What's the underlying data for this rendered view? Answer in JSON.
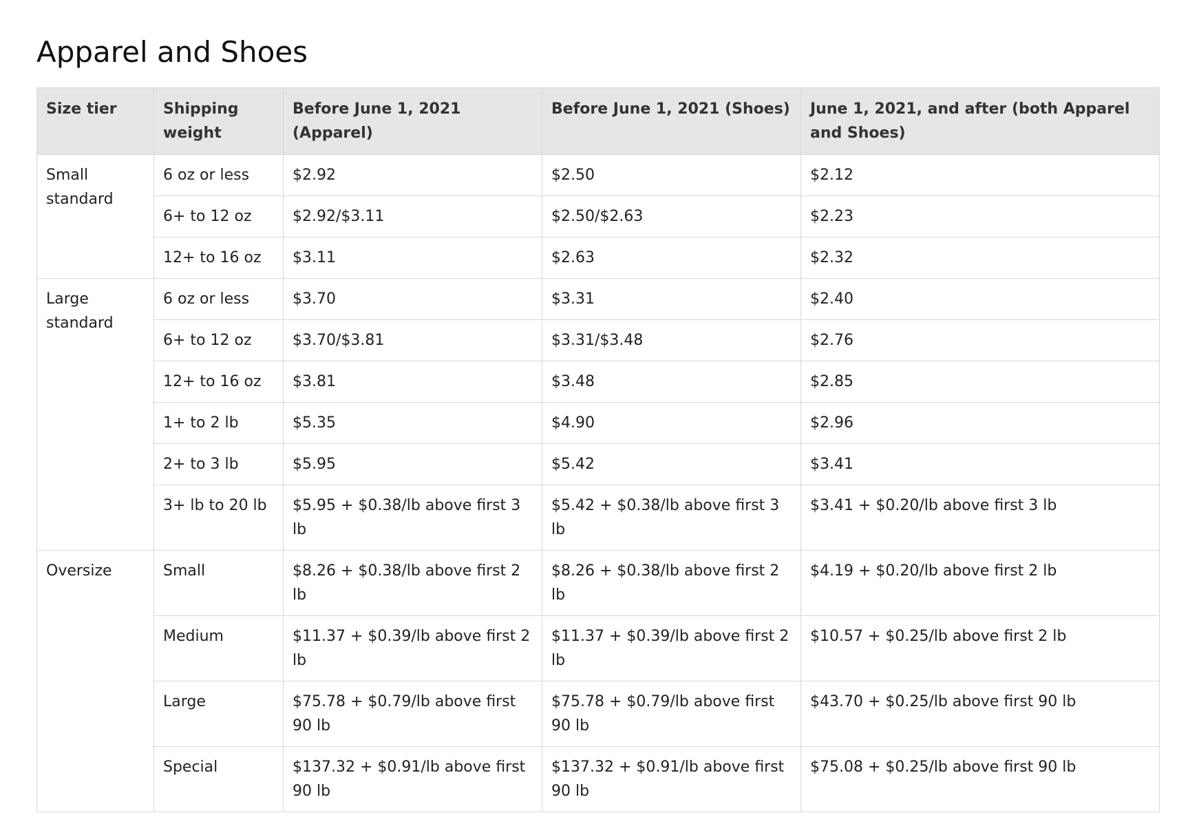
{
  "title": "Apparel and Shoes",
  "table": {
    "headers": [
      "Size tier",
      "Shipping weight",
      "Before June 1, 2021 (Apparel)",
      "Before June 1, 2021 (Shoes)",
      "June 1, 2021, and after (both Apparel and Shoes)"
    ],
    "groups": [
      {
        "tier": "Small standard",
        "rows": [
          [
            "6 oz or less",
            "$2.92",
            "$2.50",
            "$2.12"
          ],
          [
            "6+ to 12 oz",
            "$2.92/$3.11",
            "$2.50/$2.63",
            "$2.23"
          ],
          [
            "12+ to 16 oz",
            "$3.11",
            "$2.63",
            "$2.32"
          ]
        ]
      },
      {
        "tier": "Large standard",
        "rows": [
          [
            "6 oz or less",
            "$3.70",
            "$3.31",
            "$2.40"
          ],
          [
            "6+ to 12 oz",
            "$3.70/$3.81",
            "$3.31/$3.48",
            "$2.76"
          ],
          [
            "12+ to 16 oz",
            "$3.81",
            "$3.48",
            "$2.85"
          ],
          [
            "1+ to 2 lb",
            "$5.35",
            "$4.90",
            "$2.96"
          ],
          [
            "2+ to 3 lb",
            "$5.95",
            "$5.42",
            "$3.41"
          ],
          [
            "3+ lb to 20 lb",
            "$5.95 + $0.38/lb above first 3 lb",
            "$5.42 + $0.38/lb above first 3 lb",
            "$3.41 + $0.20/lb above first 3 lb"
          ]
        ]
      },
      {
        "tier": "Oversize",
        "rows": [
          [
            "Small",
            "$8.26 + $0.38/lb above first 2 lb",
            "$8.26 + $0.38/lb above first 2 lb",
            "$4.19 + $0.20/lb above first 2 lb"
          ],
          [
            "Medium",
            "$11.37 + $0.39/lb above first 2 lb",
            "$11.37 + $0.39/lb above first 2 lb",
            "$10.57 + $0.25/lb above first 2 lb"
          ],
          [
            "Large",
            "$75.78 + $0.79/lb above first 90 lb",
            "$75.78 + $0.79/lb above first 90 lb",
            "$43.70 + $0.25/lb above first 90 lb"
          ],
          [
            "Special",
            "$137.32 + $0.91/lb above first 90 lb",
            "$137.32 + $0.91/lb above first 90 lb",
            "$75.08 + $0.25/lb above first 90 lb"
          ]
        ]
      }
    ]
  }
}
